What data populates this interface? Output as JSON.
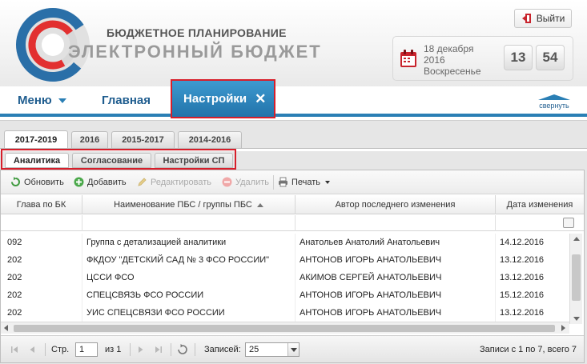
{
  "header": {
    "title_line1": "БЮДЖЕТНОЕ ПЛАНИРОВАНИЕ",
    "title_line2": "ЭЛЕКТРОННЫЙ БЮДЖЕТ",
    "logout_label": "Выйти",
    "date_line1": "18 декабря",
    "date_line2": "2016",
    "date_line3": "Воскресенье",
    "clock_hours": "13",
    "clock_minutes": "54"
  },
  "nav": {
    "menu_label": "Меню",
    "home_label": "Главная",
    "active_label": "Настройки",
    "close_glyph": "✕",
    "collapse_label": "свернуть"
  },
  "year_tabs": [
    "2017-2019",
    "2016",
    "2015-2017",
    "2014-2016"
  ],
  "sub_tabs": [
    "Аналитика",
    "Согласование",
    "Настройки СП"
  ],
  "toolbar": {
    "refresh": "Обновить",
    "add": "Добавить",
    "edit": "Редактировать",
    "delete": "Удалить",
    "print": "Печать"
  },
  "grid": {
    "columns": [
      "Глава по БК",
      "Наименование ПБС / группы ПБС",
      "Автор последнего изменения",
      "Дата изменения"
    ],
    "rows": [
      [
        "092",
        "Группа с детализацией аналитики",
        "Анатольев Анатолий Анатольевич",
        "14.12.2016"
      ],
      [
        "202",
        "ФКДОУ \"ДЕТСКИЙ САД № 3 ФСО РОССИИ\"",
        "АНТОНОВ ИГОРЬ АНАТОЛЬЕВИЧ",
        "13.12.2016"
      ],
      [
        "202",
        "ЦССИ ФСО",
        "АКИМОВ СЕРГЕЙ АНАТОЛЬЕВИЧ",
        "13.12.2016"
      ],
      [
        "202",
        "СПЕЦСВЯЗЬ ФСО РОССИИ",
        "АНТОНОВ ИГОРЬ АНАТОЛЬЕВИЧ",
        "15.12.2016"
      ],
      [
        "202",
        "УИС СПЕЦСВЯЗИ ФСО РОССИИ",
        "АНТОНОВ ИГОРЬ АНАТОЛЬЕВИЧ",
        "13.12.2016"
      ]
    ]
  },
  "pager": {
    "page_label": "Стр.",
    "page_value": "1",
    "of_label": "из 1",
    "records_label": "Записей:",
    "records_value": "25",
    "summary": "Записи с 1 по 7, всего 7"
  },
  "colors": {
    "accent": "#2a7fb5",
    "highlight": "#d71e2a"
  }
}
